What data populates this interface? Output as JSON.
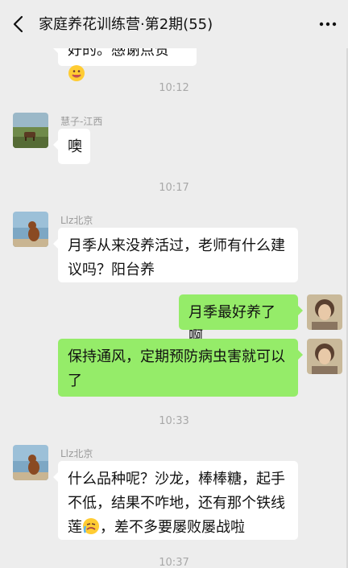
{
  "header": {
    "title": "家庭养花训练营·第2期(55)"
  },
  "messages": {
    "partial_top": {
      "text": "好的。感谢点赞"
    },
    "ts1": "10:12",
    "m1": {
      "sender": "慧子-江西",
      "text": "噢"
    },
    "ts2": "10:17",
    "m2": {
      "sender": "Llz北京",
      "text": "月季从来没养活过，老师有什么建议吗？阳台养"
    },
    "m3": {
      "text": "月季最好养了啊"
    },
    "m4": {
      "text": "保持通风，定期预防病虫害就可以了"
    },
    "ts3": "10:33",
    "m5": {
      "sender": "Llz北京",
      "text_a": "什么品种呢？沙龙，棒棒糖，起手不低，结果不咋地，还有那个铁线莲",
      "text_b": "，差不多要屡败屡战啦"
    },
    "ts4": "10:37"
  },
  "icons": {
    "back": "chevron-left-icon",
    "more": "more-dots-icon",
    "smile": "smile-emoji-icon",
    "cry": "crying-emoji-icon"
  },
  "colors": {
    "background": "#ededed",
    "incoming_bubble": "#ffffff",
    "outgoing_bubble": "#95ec69",
    "timestamp": "#a8a8a8"
  }
}
